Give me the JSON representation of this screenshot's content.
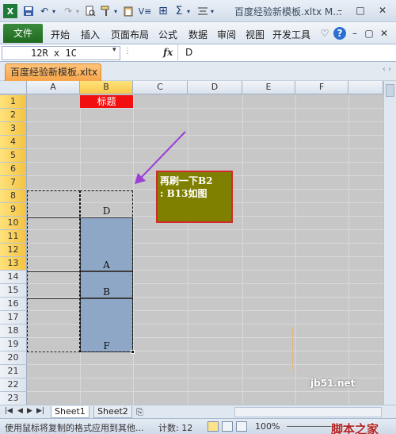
{
  "window": {
    "title": "百度经验新模板.xltx M...",
    "app_icon": "excel-icon"
  },
  "ribbon": {
    "file": "文件",
    "tabs": [
      "开始",
      "插入",
      "页面布局",
      "公式",
      "数据",
      "审阅",
      "视图",
      "开发工具"
    ],
    "help": "?"
  },
  "formula_bar": {
    "name_box": "12R x 1C",
    "fx": "fx",
    "content": "D"
  },
  "document": {
    "tab": "百度经验新模板.xltx"
  },
  "sheet": {
    "columns": [
      "A",
      "B",
      "C",
      "D",
      "E",
      "F"
    ],
    "rows": [
      "1",
      "2",
      "3",
      "4",
      "5",
      "6",
      "7",
      "8",
      "9",
      "10",
      "11",
      "12",
      "13",
      "14",
      "15",
      "16",
      "17",
      "18",
      "19",
      "20",
      "21",
      "22",
      "23"
    ],
    "selected_column": "B",
    "selected_rows": [
      "1",
      "2",
      "3",
      "4",
      "5",
      "6",
      "7",
      "8",
      "9",
      "10",
      "11",
      "12",
      "13"
    ],
    "title_cell": "标题",
    "values": {
      "b3": "D",
      "b7": "A",
      "b9": "B",
      "b13": "F"
    },
    "callout": {
      "line1": "再刷一下B2",
      "line2": ": B13如图"
    }
  },
  "sheet_tabs": [
    "Sheet1",
    "Sheet2"
  ],
  "status": {
    "message": "使用鼠标将复制的格式应用到其他...",
    "count": "计数: 12",
    "zoom": "100%"
  },
  "watermark": {
    "domain": "jb51.net",
    "brand": "脚本之家"
  },
  "colors": {
    "title_cell_bg": "#f20f0f",
    "selection_blue": "#8fa7c7",
    "callout_bg": "#808000",
    "callout_border": "#d22a2a",
    "arrow": "#9b3fd6",
    "file_tab": "#217346"
  }
}
